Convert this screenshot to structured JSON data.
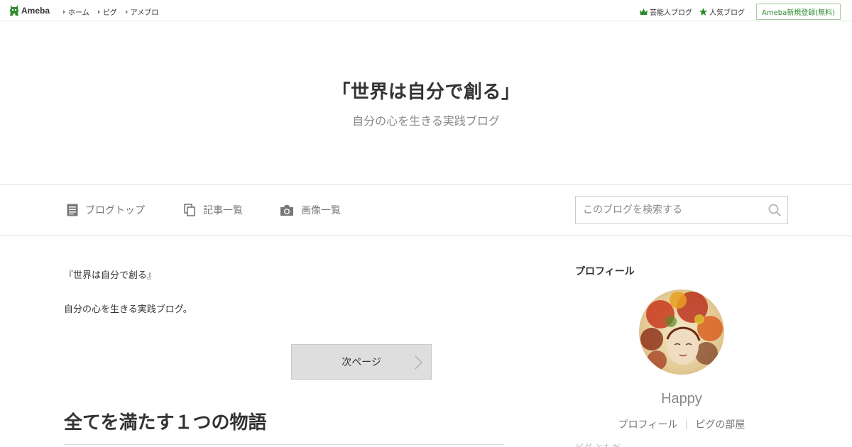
{
  "topbar": {
    "logo_text": "Ameba",
    "nav": [
      "ホーム",
      "ピグ",
      "アメブロ"
    ],
    "celebrity_blog": "芸能人ブログ",
    "popular_blog": "人気ブログ",
    "register": "Ameba新規登録(無料)",
    "brand_color": "#2d8a2d"
  },
  "header": {
    "title": "「世界は自分で創る」",
    "subtitle": "自分の心を生きる実践ブログ"
  },
  "nav": {
    "blog_top": "ブログトップ",
    "entry_list": "記事一覧",
    "image_list": "画像一覧",
    "search_placeholder": "このブログを検索する"
  },
  "main": {
    "intro_line1": "『世界は自分で創る』",
    "intro_line2": "自分の心を生きる実践ブログ。",
    "next_page": "次ページ",
    "article_title": "全てを満たす１つの物語"
  },
  "sidebar": {
    "heading": "プロフィール",
    "name": "Happy",
    "profile_link": "プロフィール",
    "pig_room_link": "ピグの部屋",
    "cut_text": "ピグ ともだ"
  }
}
